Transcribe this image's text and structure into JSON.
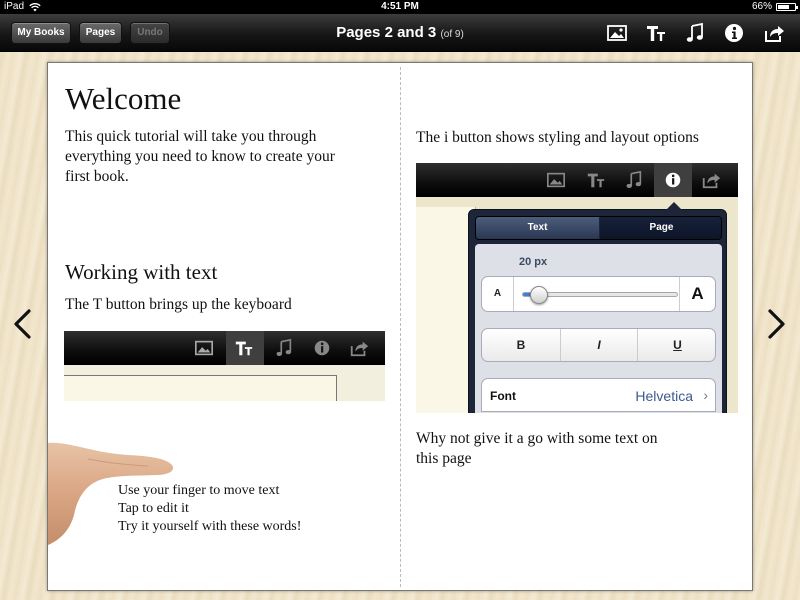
{
  "status_bar": {
    "device": "iPad",
    "time": "4:51 PM",
    "battery_text": "66%",
    "battery_level": 0.66
  },
  "toolbar": {
    "my_books": "My Books",
    "pages": "Pages",
    "undo": "Undo",
    "title": "Pages 2 and 3",
    "title_sub": "(of 9)",
    "icons": [
      "image-icon",
      "text-style-icon",
      "music-icon",
      "info-icon",
      "share-icon"
    ]
  },
  "page_left": {
    "heading": "Welcome",
    "intro_lines": [
      "This quick tutorial will take you through",
      "everything you need to know to create your",
      "first book."
    ],
    "subheading": "Working with text",
    "t_button_text": "The T button brings up the keyboard",
    "finger_lines": [
      "Use your finger to move text",
      "Tap to edit it",
      "Try it yourself with these words!"
    ]
  },
  "page_right": {
    "i_button_text": "The i button shows styling and layout options",
    "popover": {
      "tab_text": "Text",
      "tab_page": "Page",
      "size_label": "20 px",
      "size_fraction": 0.1,
      "small_a": "A",
      "big_a": "A",
      "bold": "B",
      "italic": "I",
      "underline": "U",
      "font_label": "Font",
      "font_value": "Helvetica",
      "chevron": "›"
    },
    "closing_lines": [
      "Why not give it a go with some text on",
      "this page"
    ]
  },
  "colors": {
    "accent_blue": "#3e7fd8",
    "popover_navy": "#1c2638",
    "font_value_blue": "#3c5a8c"
  }
}
